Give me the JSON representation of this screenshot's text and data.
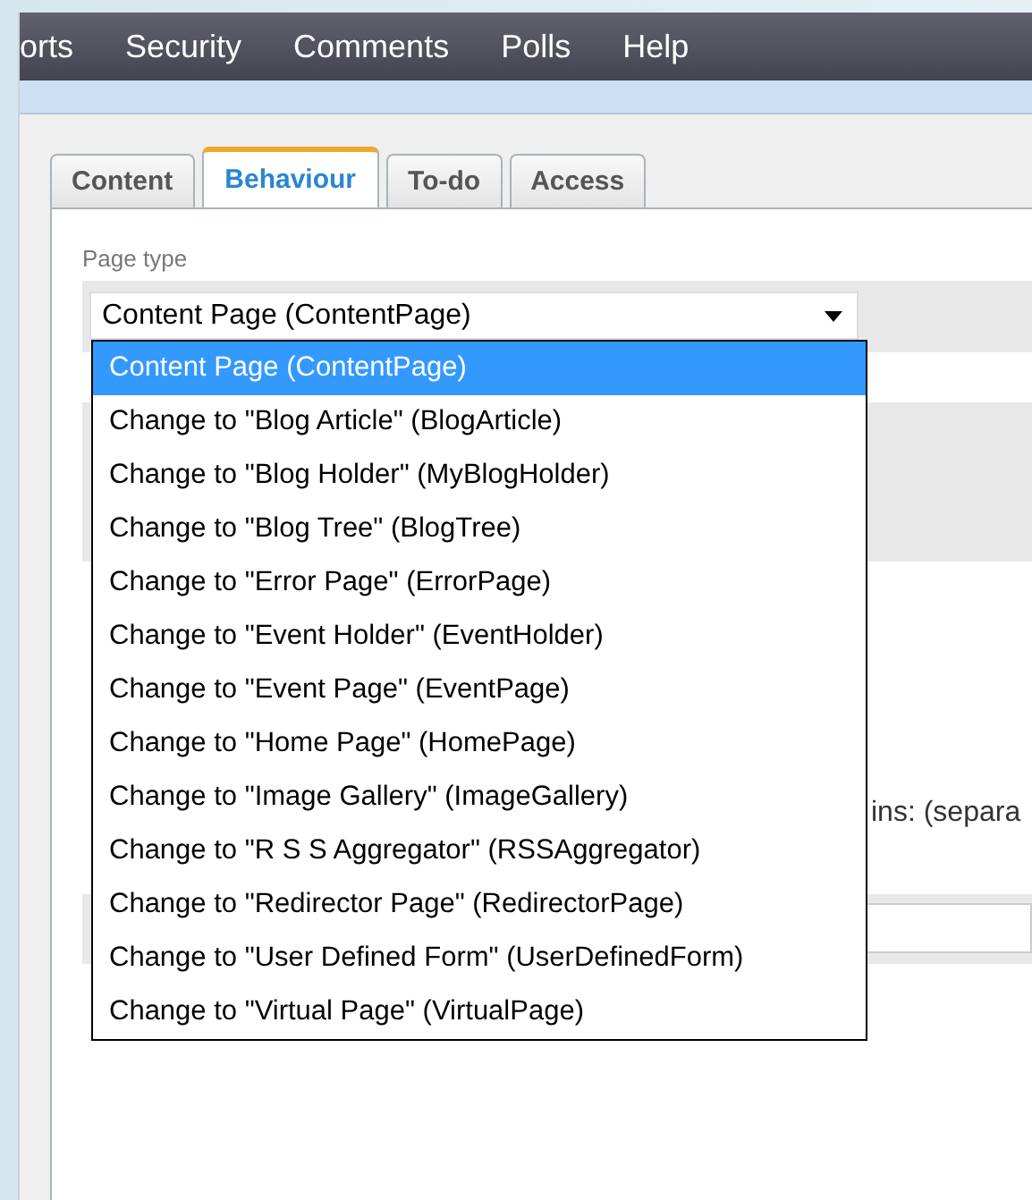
{
  "nav_menu": [
    {
      "label": "orts"
    },
    {
      "label": "Security"
    },
    {
      "label": "Comments"
    },
    {
      "label": "Polls"
    },
    {
      "label": "Help"
    }
  ],
  "tabs": [
    {
      "label": "Content",
      "selected": false
    },
    {
      "label": "Behaviour",
      "selected": true
    },
    {
      "label": "To-do",
      "selected": false
    },
    {
      "label": "Access",
      "selected": false
    }
  ],
  "page_type": {
    "label": "Page type",
    "value": "Content Page (ContentPage)",
    "expanded": true,
    "options": [
      {
        "label": "Content Page (ContentPage)",
        "selected": true
      },
      {
        "label": "Change to \"Blog Article\" (BlogArticle)",
        "selected": false
      },
      {
        "label": "Change to \"Blog Holder\" (MyBlogHolder)",
        "selected": false
      },
      {
        "label": "Change to \"Blog Tree\" (BlogTree)",
        "selected": false
      },
      {
        "label": "Change to \"Error Page\" (ErrorPage)",
        "selected": false
      },
      {
        "label": "Change to \"Event Holder\" (EventHolder)",
        "selected": false
      },
      {
        "label": "Change to \"Event Page\" (EventPage)",
        "selected": false
      },
      {
        "label": "Change to \"Home Page\" (HomePage)",
        "selected": false
      },
      {
        "label": "Change to \"Image Gallery\" (ImageGallery)",
        "selected": false
      },
      {
        "label": "Change to \"R S S Aggregator\" (RSSAggregator)",
        "selected": false
      },
      {
        "label": "Change to \"Redirector Page\" (RedirectorPage)",
        "selected": false
      },
      {
        "label": "Change to \"User Defined Form\" (UserDefinedForm)",
        "selected": false
      },
      {
        "label": "Change to \"Virtual Page\" (VirtualPage)",
        "selected": false
      }
    ]
  },
  "partial_label": "ins: (separa"
}
